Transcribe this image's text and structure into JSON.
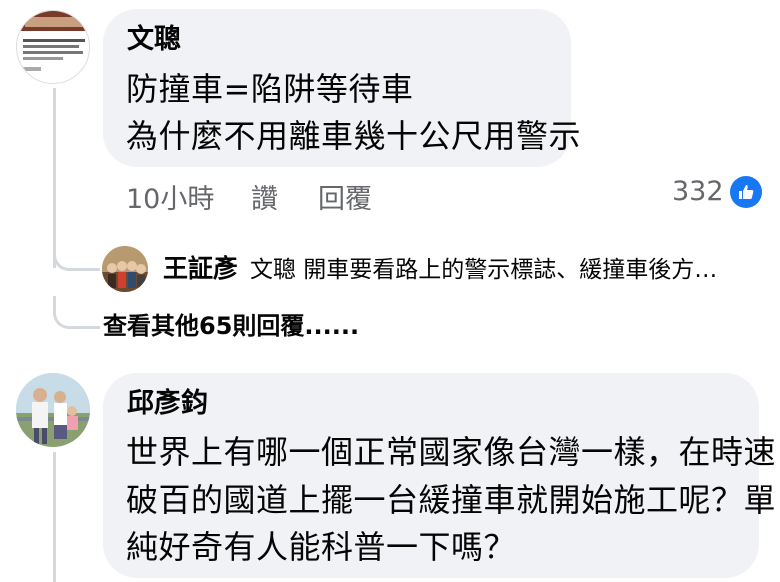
{
  "comments": [
    {
      "author": "文聰",
      "lines": [
        "防撞車=陷阱等待車",
        "為什麼不用離車幾十公尺用警示"
      ],
      "time": "10小時",
      "like_label": "讚",
      "reply_label": "回覆",
      "reaction_count": "332",
      "reaction_icon": "like-icon",
      "reply_preview": {
        "author": "王証彥",
        "text": "文聰 開車要看路上的警示標誌、緩撞車後方…"
      },
      "more_replies_label": "查看其他65則回覆......"
    },
    {
      "author": "邱彥鈞",
      "lines": [
        "世界上有哪一個正常國家像台灣一樣，在時速",
        "破百的國道上擺一台緩撞車就開始施工呢？單",
        "純好奇有人能科普一下嗎？"
      ]
    }
  ],
  "colors": {
    "bubble_bg": "#f0f2f5",
    "text": "#050505",
    "secondary_text": "#65676b",
    "like_blue": "#1877f2",
    "thread_line": "#d5d8dc"
  }
}
